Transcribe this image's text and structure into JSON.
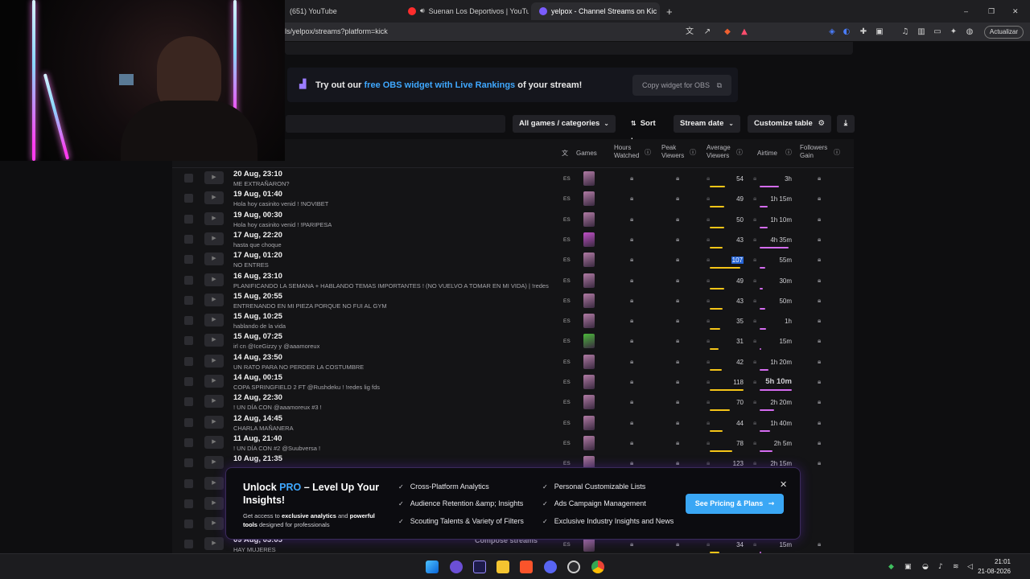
{
  "browser": {
    "tabs": [
      {
        "label": "(651) YouTube",
        "icon": "youtube-icon",
        "color": "#ff0000"
      },
      {
        "label": "Suenan Los Deportivos | YouTube",
        "icon": "youtube-icon",
        "color": "#ff2d2d"
      },
      {
        "label": "yelpox - Channel Streams on Kic",
        "icon": "streamscharts-icon",
        "color": "#7a5cff",
        "active": true
      }
    ],
    "new_tab": "+",
    "url": "ls/yelpox/streams?platform=kick",
    "update_label": "Actualizar",
    "window_controls": [
      "–",
      "❐",
      "✕"
    ]
  },
  "promo": {
    "text_prefix": "Try out our",
    "link": "free OBS widget with Live Rankings",
    "text_suffix": "of your stream!",
    "copy_button": "Copy widget for OBS"
  },
  "controls": {
    "games_filter": "All games / categories",
    "sort_label": "Sort by:",
    "sort_value": "Stream date",
    "customize": "Customize table"
  },
  "table": {
    "headers": {
      "games": "Games",
      "hours_watched": [
        "Hours",
        "Watched"
      ],
      "peak_viewers": [
        "Peak",
        "Viewers"
      ],
      "avg_viewers": [
        "Average",
        "Viewers"
      ],
      "airtime": "Airtime",
      "followers": [
        "Followers",
        "Gain"
      ]
    },
    "rows": [
      {
        "date": "20 Aug, 23:10",
        "title": "ME EXTRAÑARON?",
        "lang": "ES",
        "avg": "54",
        "air": "3h",
        "avg_level": 0.46,
        "air_level": 0.6,
        "thumb": "#b07ba4"
      },
      {
        "date": "19 Aug, 01:40",
        "title": "Hola hoy casinito venid ! !NOVIBET",
        "lang": "ES",
        "avg": "49",
        "air": "1h 15m",
        "avg_level": 0.42,
        "air_level": 0.25,
        "thumb": "#b07ba4"
      },
      {
        "date": "19 Aug, 00:30",
        "title": "Hola hoy casinito venid ! !PARIPESA",
        "lang": "ES",
        "avg": "50",
        "air": "1h 10m",
        "avg_level": 0.43,
        "air_level": 0.24,
        "thumb": "#b07ba4"
      },
      {
        "date": "17 Aug, 22:20",
        "title": "hasta que choque",
        "lang": "ES",
        "avg": "43",
        "air": "4h 35m",
        "avg_level": 0.37,
        "air_level": 0.9,
        "thumb": "#c050c8"
      },
      {
        "date": "17 Aug, 01:20",
        "title": "NO ENTRES",
        "lang": "ES",
        "avg": "107",
        "air": "55m",
        "avg_level": 0.9,
        "air_level": 0.18,
        "thumb": "#b07ba4",
        "highlight": true
      },
      {
        "date": "16 Aug, 23:10",
        "title": "PLANIFICANDO LA SEMANA + HABLANDO TEMAS IMPORTANTES ! (NO VUELVO A TOMAR EN MI VIDA) | !redes",
        "lang": "ES",
        "avg": "49",
        "air": "30m",
        "avg_level": 0.42,
        "air_level": 0.1,
        "thumb": "#b07ba4"
      },
      {
        "date": "15 Aug, 20:55",
        "title": "ENTRENANDO EN MI PIEZA PORQUE NO FUI AL GYM",
        "lang": "ES",
        "avg": "43",
        "air": "50m",
        "avg_level": 0.37,
        "air_level": 0.17,
        "thumb": "#b07ba4"
      },
      {
        "date": "15 Aug, 10:25",
        "title": "hablando de la vida",
        "lang": "ES",
        "avg": "35",
        "air": "1h",
        "avg_level": 0.3,
        "air_level": 0.2,
        "thumb": "#b07ba4"
      },
      {
        "date": "15 Aug, 07:25",
        "title": "irl cn @IceGizzy y @aaamoreux",
        "lang": "ES",
        "avg": "31",
        "air": "15m",
        "avg_level": 0.27,
        "air_level": 0.05,
        "thumb": "#4bb83a"
      },
      {
        "date": "14 Aug, 23:50",
        "title": "UN RATO PARA NO PERDER LA COSTUMBRE",
        "lang": "ES",
        "avg": "42",
        "air": "1h 20m",
        "avg_level": 0.36,
        "air_level": 0.27,
        "thumb": "#b07ba4"
      },
      {
        "date": "14 Aug, 00:15",
        "title": "COPA SPRINGFIELD 2 FT @Rushdeku ! !redes lig fds",
        "lang": "ES",
        "avg": "118",
        "air": "5h 10m",
        "avg_level": 1.0,
        "air_level": 1.0,
        "thumb": "#b07ba4",
        "bold_air": true
      },
      {
        "date": "12 Aug, 22:30",
        "title": "! UN DÍA CON @aaamoreux #3 !",
        "lang": "ES",
        "avg": "70",
        "air": "2h 20m",
        "avg_level": 0.6,
        "air_level": 0.46,
        "thumb": "#b07ba4"
      },
      {
        "date": "12 Aug, 14:45",
        "title": "CHARLA MAÑANERA",
        "lang": "ES",
        "avg": "44",
        "air": "1h 40m",
        "avg_level": 0.38,
        "air_level": 0.33,
        "thumb": "#b07ba4"
      },
      {
        "date": "11 Aug, 21:40",
        "title": "! UN DÍA CON #2 @Suubversa !",
        "lang": "ES",
        "avg": "78",
        "air": "2h 5m",
        "avg_level": 0.66,
        "air_level": 0.41,
        "thumb": "#b07ba4"
      },
      {
        "date": "10 Aug, 21:35",
        "title": "",
        "lang": "ES",
        "avg": "123",
        "air": "2h 15m",
        "avg_level": 1.0,
        "air_level": 0.45,
        "thumb": "#b07ba4"
      },
      {
        "date": "",
        "title": "",
        "lang": "",
        "avg": "",
        "air": "",
        "avg_level": 0,
        "air_level": 0,
        "thumb": "#1b1b1f"
      },
      {
        "date": "",
        "title": "",
        "lang": "",
        "avg": "",
        "air": "",
        "avg_level": 0,
        "air_level": 0,
        "thumb": "#1b1b1f"
      },
      {
        "date": "",
        "title": "",
        "lang": "",
        "avg": "",
        "air": "",
        "avg_level": 0,
        "air_level": 0,
        "thumb": "#1b1b1f"
      },
      {
        "date": "09 Aug, 03:05",
        "title": "HAY MUJERES",
        "lang": "ES",
        "avg": "34",
        "air": "15m",
        "avg_level": 0.29,
        "air_level": 0.05,
        "thumb": "#b07ba4",
        "compose": "Compose streams"
      }
    ]
  },
  "pro_modal": {
    "title_prefix": "Unlock",
    "title_pro": "PRO",
    "title_suffix": "– Level Up Your Insights!",
    "sub_1": "Get access to",
    "sub_bold_1": "exclusive analytics",
    "sub_2": "and",
    "sub_bold_2": "powerful tools",
    "sub_3": "designed for professionals",
    "features_left": [
      "Cross-Platform Analytics",
      "Audience Retention &amp; Insights",
      "Scouting Talents & Variety of Filters"
    ],
    "features_right": [
      "Personal Customizable Lists",
      "Ads Campaign Management",
      "Exclusive Industry Insights and News"
    ],
    "cta": "See Pricing & Plans"
  },
  "taskbar": {
    "time": "21:01",
    "date": "21-08-2026"
  }
}
